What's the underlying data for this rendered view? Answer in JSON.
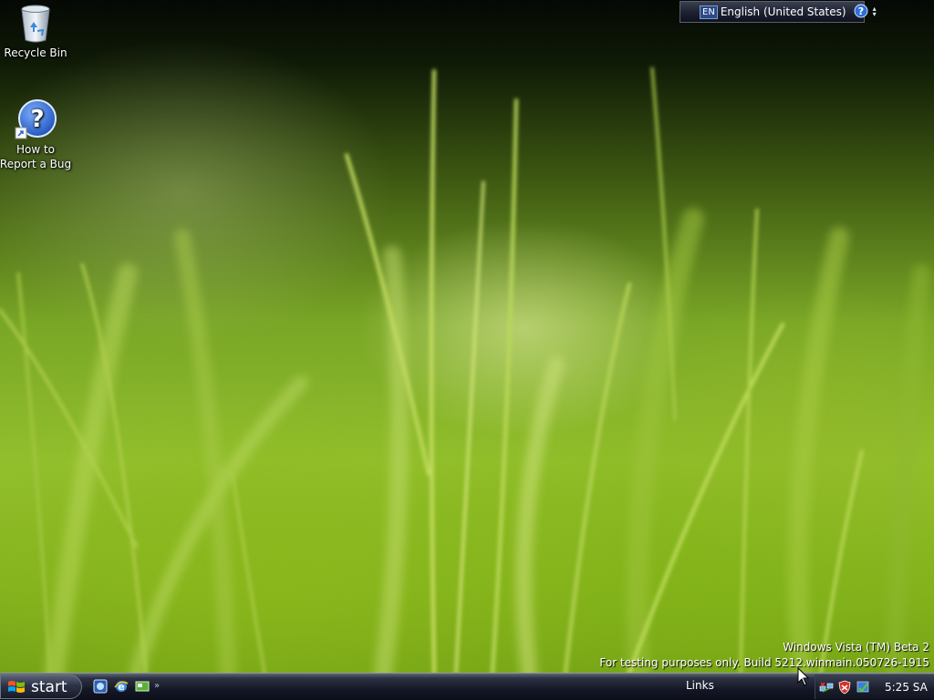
{
  "desktop": {
    "icons": [
      {
        "label": "Recycle Bin",
        "icon": "recycle-bin-icon"
      },
      {
        "label": "How to\nReport a Bug",
        "label_line1": "How to",
        "label_line2": "Report a Bug",
        "icon": "help-question-icon"
      }
    ],
    "wallpaper": {
      "name": "green grass",
      "colors": [
        "#0f1a06",
        "#79a626",
        "#92bf2d"
      ]
    }
  },
  "language_bar": {
    "code": "EN",
    "language": "English (United States)",
    "help_icon": "help-icon",
    "options_icon": "options-arrows-icon"
  },
  "watermark": {
    "line1": "Windows Vista (TM) Beta 2",
    "line2": "For testing purposes only. Build 5212.winmain.050726-1915"
  },
  "taskbar": {
    "start_label": "start",
    "quick_launch": [
      {
        "icon": "windows-media-icon"
      },
      {
        "icon": "internet-explorer-icon"
      },
      {
        "icon": "show-desktop-icon"
      }
    ],
    "links_label": "Links",
    "tray_icons": [
      "network-icon",
      "security-shield-icon",
      "update-icon"
    ],
    "clock": "5:25 SA"
  },
  "colors": {
    "taskbar": "#141826",
    "accent": "#2a4a8a",
    "grass": "#92bf2d"
  }
}
